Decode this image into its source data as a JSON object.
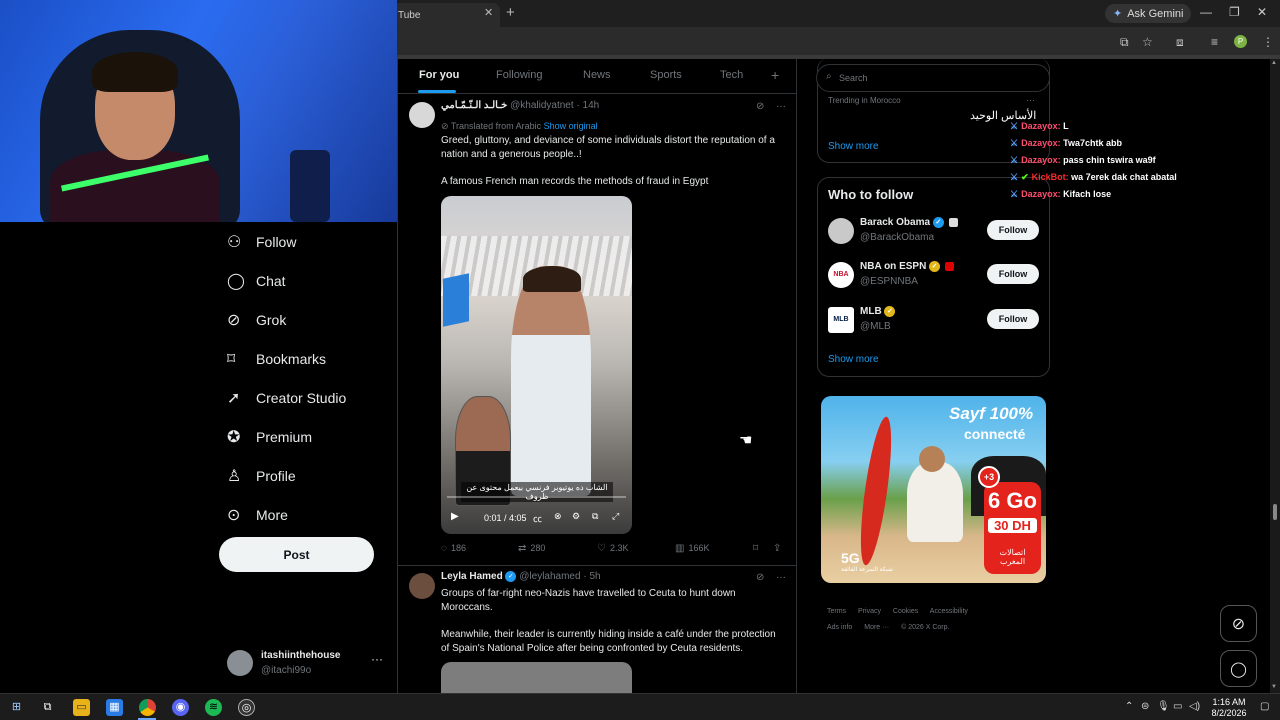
{
  "browser": {
    "active_tab_title": "Tube",
    "ask_gemini_label": "Ask Gemini",
    "profile_initial": "P"
  },
  "nav": {
    "items": [
      {
        "label": "Follow",
        "icon": "person-plus-icon"
      },
      {
        "label": "Chat",
        "icon": "chat-bubble-icon"
      },
      {
        "label": "Grok",
        "icon": "grok-icon"
      },
      {
        "label": "Bookmarks",
        "icon": "bookmark-icon"
      },
      {
        "label": "Creator Studio",
        "icon": "rocket-icon"
      },
      {
        "label": "Premium",
        "icon": "verified-badge-icon"
      },
      {
        "label": "Profile",
        "icon": "person-icon"
      },
      {
        "label": "More",
        "icon": "more-circle-icon"
      }
    ],
    "post_label": "Post",
    "account": {
      "name": "itashiinthehouse",
      "handle": "@itachi99o"
    }
  },
  "feed": {
    "tabs": [
      "For you",
      "Following",
      "News",
      "Sports",
      "Tech"
    ],
    "active_tab": "For you",
    "posts": [
      {
        "name": "خـالـد الـنّـمّـامي",
        "handle": "@khalidyatnet",
        "time": "· 14h",
        "translated_label": "Translated from Arabic",
        "show_original": "Show original",
        "text_1": "Greed, gluttony, and deviance of some individuals distort the reputation of a nation and a generous people..!",
        "text_2": "A famous French man records the methods of fraud in Egypt",
        "video": {
          "caption": "الشاب ده يوتيوبر فرنسي بيعمل محتوى عن ظروف",
          "time": "0:01 / 4:05"
        },
        "stats": {
          "replies": "186",
          "reposts": "280",
          "likes": "2.3K",
          "views": "166K"
        }
      },
      {
        "name": "Leyla Hamed",
        "handle": "@leylahamed",
        "time": "· 5h",
        "text_1": "Groups of far-right neo-Nazis have travelled to Ceuta to hunt down Moroccans.",
        "text_2": "Meanwhile, their leader is currently hiding inside a café under the protection of Spain's National Police after being confronted by Ceuta residents."
      }
    ]
  },
  "sidebar": {
    "search_placeholder": "Search",
    "trending_meta": "Trending in Morocco",
    "trend_show_more": "Show more",
    "who_to_follow": {
      "title": "Who to follow",
      "accounts": [
        {
          "name": "Barack Obama",
          "handle": "@BarackObama",
          "button": "Follow"
        },
        {
          "name": "NBA on ESPN",
          "handle": "@ESPNNBA",
          "button": "Follow",
          "avatar_text": "NBA"
        },
        {
          "name": "MLB",
          "handle": "@MLB",
          "button": "Follow",
          "avatar_text": "MLB"
        }
      ],
      "show_more": "Show more"
    },
    "ad": {
      "headline_1": "Sayf 100%",
      "headline_2": "connecté",
      "plus": "+3",
      "data": "6 Go",
      "price": "30 DH",
      "brand": "اتصالات المغرب",
      "network": "5G",
      "network_sub": "شبكة السرعة الفائقة"
    },
    "footer": [
      "Terms",
      "Privacy",
      "Cookies",
      "Accessibility",
      "Ads info",
      "More ···",
      "© 2026 X Corp."
    ]
  },
  "overlay": {
    "arabic_text": "الأساس الوحيد",
    "chat": [
      {
        "user": "Dazayox:",
        "msg": "L"
      },
      {
        "user": "Dazayox:",
        "msg": "Twa7chtk abb"
      },
      {
        "user": "Dazayox:",
        "msg": "pass chin tswira wa9f"
      },
      {
        "user": "KickBot:",
        "msg": "wa 7erek dak chat abatal"
      },
      {
        "user": "Dazayox:",
        "msg": "Kifach lose"
      }
    ]
  },
  "taskbar": {
    "time": "1:16 AM",
    "date": "8/2/2026"
  },
  "colors": {
    "accent": "#1d9bf0",
    "background": "#000000",
    "text_primary": "#e7e9ea",
    "text_secondary": "#71767b",
    "border": "#2f3336",
    "chat_username": "#ff4d6d"
  }
}
